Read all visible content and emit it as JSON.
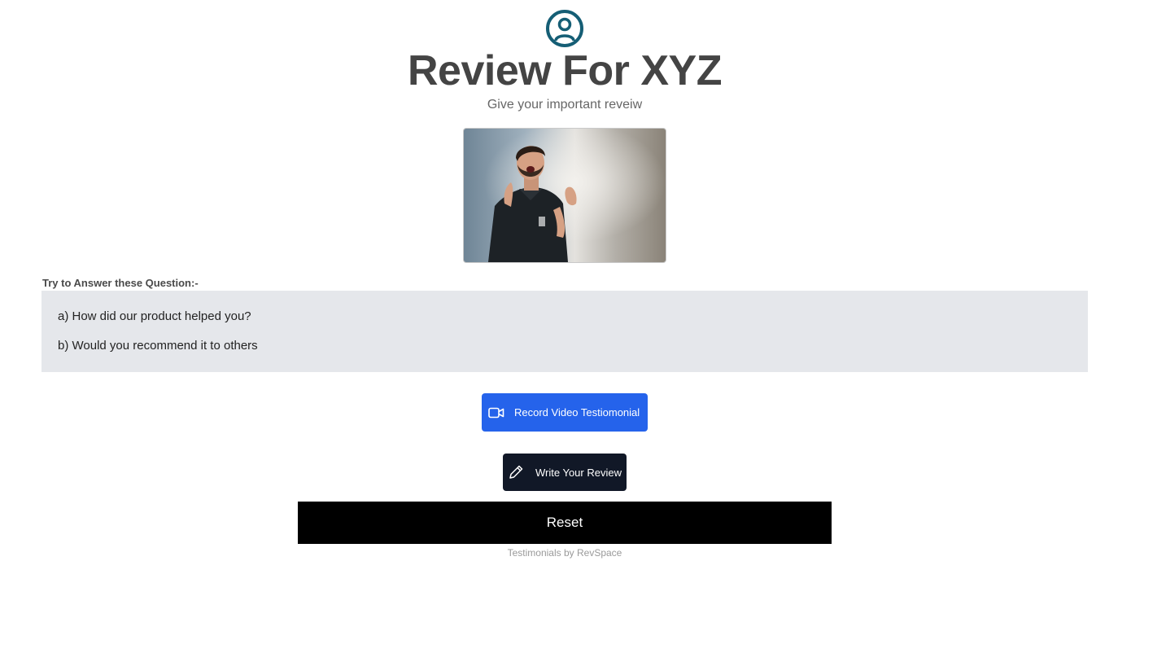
{
  "header": {
    "logo_icon": "user-circle-icon",
    "logo_color": "#155e75",
    "title": "Review For XYZ",
    "subtitle": "Give your important reveiw"
  },
  "media": {
    "image_icon": "person-photo"
  },
  "questions": {
    "heading": "Try to Answer these Question:-",
    "items": [
      "a) How did our product helped you?",
      "b) Would you recommend it to others"
    ]
  },
  "actions": {
    "record_label": "Record Video Testiomonial",
    "record_icon": "video-camera-icon",
    "record_color": "#2563eb",
    "write_label": "Write Your Review",
    "write_icon": "pencil-icon",
    "write_color": "#111827",
    "reset_label": "Reset"
  },
  "footer": {
    "text": "Testimonials by RevSpace"
  }
}
